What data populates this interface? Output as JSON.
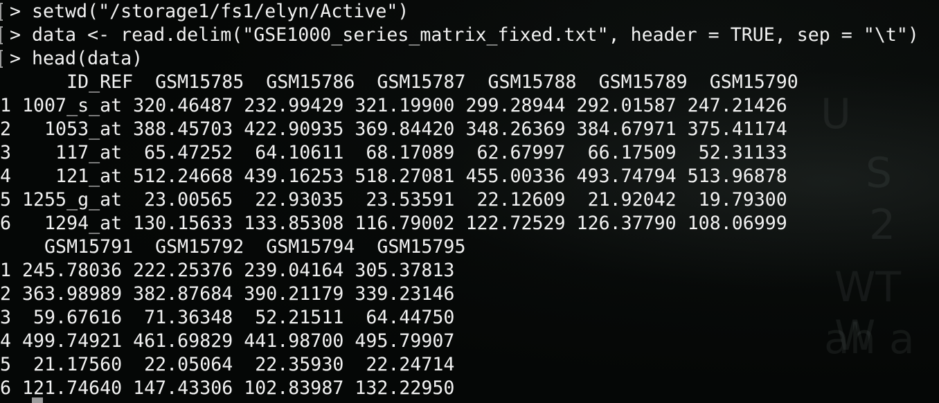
{
  "terminal": {
    "commands": [
      "> setwd(\"/storage1/fs1/elyn/Active\")",
      "> data <- read.delim(\"GSE1000_series_matrix_fixed.txt\", header = TRUE, sep = \"\\t\")",
      "> head(data)"
    ],
    "output": [
      "      ID_REF  GSM15785  GSM15786  GSM15787  GSM15788  GSM15789  GSM15790",
      "1 1007_s_at 320.46487 232.99429 321.19900 299.28944 292.01587 247.21426",
      "2   1053_at 388.45703 422.90935 369.84420 348.26369 384.67971 375.41174",
      "3    117_at  65.47252  64.10611  68.17089  62.67997  66.17509  52.31133",
      "4    121_at 512.24668 439.16253 518.27081 455.00336 493.74794 513.96878",
      "5 1255_g_at  23.00565  22.93035  23.53591  22.12609  21.92042  19.79300",
      "6   1294_at 130.15633 133.85308 116.79002 122.72529 126.37790 108.06999",
      "    GSM15791  GSM15792  GSM15794  GSM15795",
      "1 245.78036 222.25376 239.04164 305.37813",
      "2 363.98989 382.87684 390.21179 339.23146",
      "3  59.67616  71.36348  52.21511  64.44750",
      "4 499.74921 461.69829 441.98700 495.79907",
      "5  21.17560  22.05064  22.35930  22.24714",
      "6 121.74640 147.43306 102.83987 132.22950"
    ]
  },
  "colors": {
    "background": "#050706",
    "text": "#f2f2f2",
    "prompt_bracket": "#9a9a9a"
  }
}
